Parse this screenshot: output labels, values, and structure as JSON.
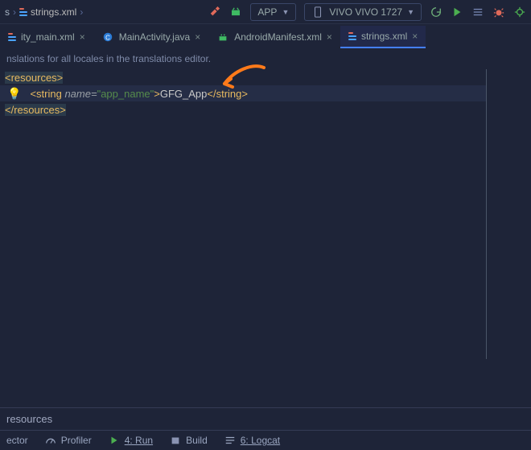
{
  "breadcrumb": {
    "seg0": "s",
    "file": "strings.xml"
  },
  "toolbar": {
    "config_label": "APP",
    "device_label": "VIVO VIVO 1727"
  },
  "tabs": {
    "t0": {
      "label": "ity_main.xml"
    },
    "t1": {
      "label": "MainActivity.java"
    },
    "t2": {
      "label": "AndroidManifest.xml"
    },
    "t3": {
      "label": "strings.xml"
    }
  },
  "hint": "nslations for all locales in the translations editor.",
  "code": {
    "open_resources": "resources",
    "close_resources": "/resources",
    "string_tag_open": "string",
    "string_tag_close": "/string",
    "attr_name": "name",
    "attr_val": "\"app_name\"",
    "text": "GFG_App"
  },
  "status": {
    "path": "resources"
  },
  "bottom": {
    "inspector": "ector",
    "profiler": "Profiler",
    "run": "4: Run",
    "build": "Build",
    "logcat": "6: Logcat"
  }
}
